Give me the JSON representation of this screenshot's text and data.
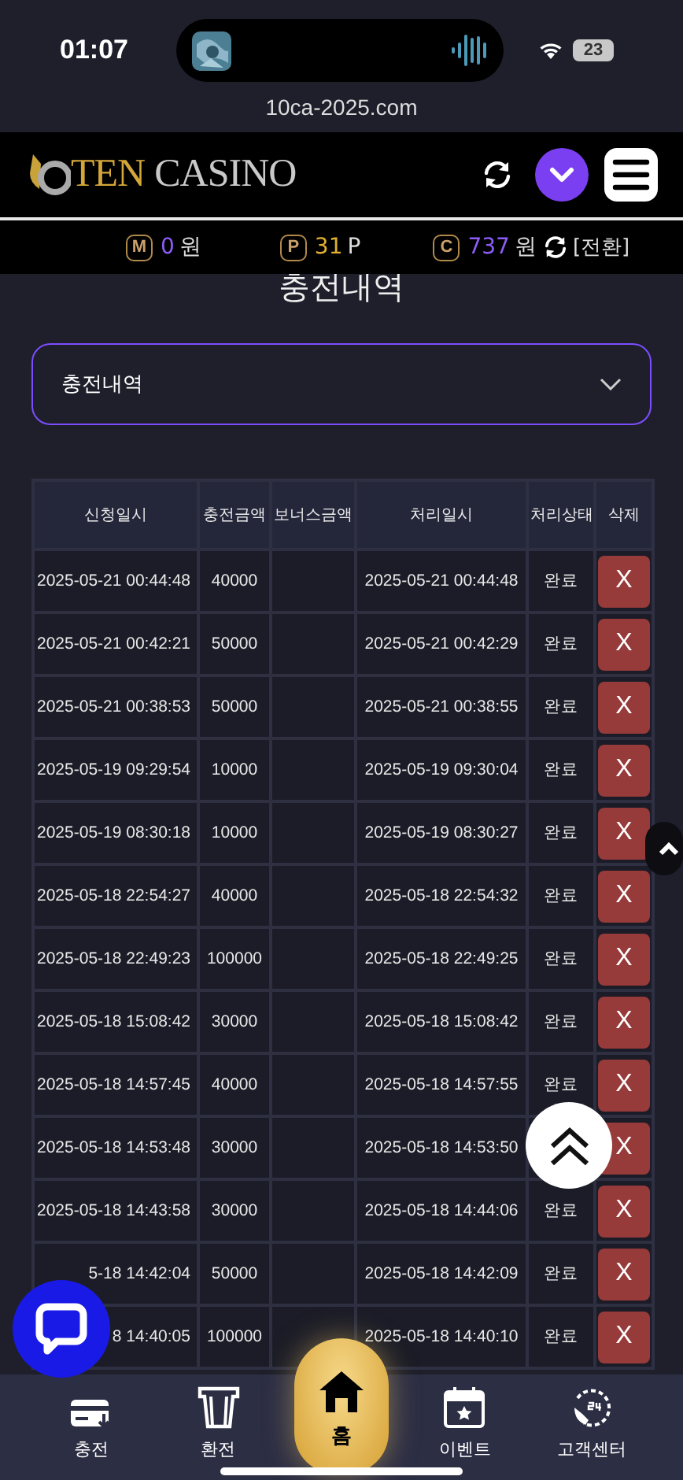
{
  "status_bar": {
    "time": "01:07",
    "battery": "23"
  },
  "address_bar": {
    "url": "10ca-2025.com"
  },
  "header": {
    "logo": {
      "first": "TEN",
      "second": "CASINO"
    }
  },
  "balances": [
    {
      "badge": "M",
      "amount": "0",
      "unit": "원",
      "color": "#8b5cf6"
    },
    {
      "badge": "P",
      "amount": "31",
      "unit": "P",
      "color": "#e0b030"
    },
    {
      "badge": "C",
      "amount": "737",
      "unit": "원",
      "color": "#8b5cf6"
    }
  ],
  "convert_link": "[전환]",
  "page_title": "충전내역",
  "filter": {
    "value": "충전내역"
  },
  "table": {
    "columns": [
      "신청일시",
      "충전금액",
      "보너스금액",
      "처리일시",
      "처리상태",
      "삭제"
    ],
    "rows": [
      {
        "requested": "2025-05-21 00:44:48",
        "amount": "40000",
        "processed": "2025-05-21 00:44:48",
        "status": "완료",
        "delete": "X"
      },
      {
        "requested": "2025-05-21 00:42:21",
        "amount": "50000",
        "processed": "2025-05-21 00:42:29",
        "status": "완료",
        "delete": "X"
      },
      {
        "requested": "2025-05-21 00:38:53",
        "amount": "50000",
        "processed": "2025-05-21 00:38:55",
        "status": "완료",
        "delete": "X"
      },
      {
        "requested": "2025-05-19 09:29:54",
        "amount": "10000",
        "processed": "2025-05-19 09:30:04",
        "status": "완료",
        "delete": "X"
      },
      {
        "requested": "2025-05-19 08:30:18",
        "amount": "10000",
        "processed": "2025-05-19 08:30:27",
        "status": "완료",
        "delete": "X"
      },
      {
        "requested": "2025-05-18 22:54:27",
        "amount": "40000",
        "processed": "2025-05-18 22:54:32",
        "status": "완료",
        "delete": "X"
      },
      {
        "requested": "2025-05-18 22:49:23",
        "amount": "100000",
        "processed": "2025-05-18 22:49:25",
        "status": "완료",
        "delete": "X"
      },
      {
        "requested": "2025-05-18 15:08:42",
        "amount": "30000",
        "processed": "2025-05-18 15:08:42",
        "status": "완료",
        "delete": "X"
      },
      {
        "requested": "2025-05-18 14:57:45",
        "amount": "40000",
        "processed": "2025-05-18 14:57:55",
        "status": "완료",
        "delete": "X"
      },
      {
        "requested": "2025-05-18 14:53:48",
        "amount": "30000",
        "processed": "2025-05-18 14:53:50",
        "delete": "X"
      },
      {
        "requested": "2025-05-18 14:43:58",
        "amount": "30000",
        "processed": "2025-05-18 14:44:06",
        "status": "완료",
        "delete": "X"
      },
      {
        "requested": "5-18 14:42:04",
        "amount": "50000",
        "processed": "2025-05-18 14:42:09",
        "status": "완료",
        "delete": "X"
      },
      {
        "requested": "8 14:40:05",
        "amount": "100000",
        "processed": "2025-05-18 14:40:10",
        "status": "완료",
        "delete": "X"
      }
    ]
  },
  "bottom_nav": [
    {
      "kind": "card",
      "label": "충전",
      "selected": false
    },
    {
      "kind": "atm",
      "label": "환전",
      "selected": false
    },
    {
      "kind": "home",
      "label": "홈",
      "selected": true
    },
    {
      "kind": "calendar",
      "label": "이벤트",
      "selected": false
    },
    {
      "kind": "clock",
      "label": "고객센터",
      "selected": false
    }
  ]
}
